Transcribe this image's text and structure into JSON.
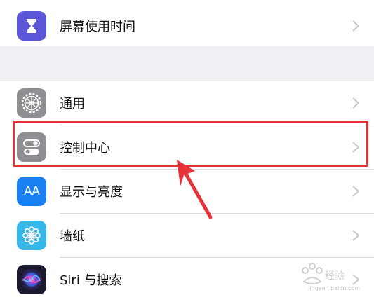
{
  "rows": [
    {
      "label": "屏幕使用时间",
      "icon": "hourglass-icon",
      "color": "#5b55d8"
    },
    {
      "label": "通用",
      "icon": "gear-icon",
      "color": "#8e8e93"
    },
    {
      "label": "控制中心",
      "icon": "toggle-switches-icon",
      "color": "#8e8e93"
    },
    {
      "label": "显示与亮度",
      "icon": "text-size-icon",
      "color": "#1a7ff0",
      "icon_text": "AA"
    },
    {
      "label": "墙纸",
      "icon": "flower-icon",
      "color": "#37b6e8"
    },
    {
      "label": "Siri 与搜索",
      "icon": "siri-icon",
      "color": "#1b1b2e"
    }
  ],
  "annotation": {
    "highlight_color": "#e8323a",
    "highlighted_row": "控制中心"
  },
  "watermark": {
    "text": "Baidu经验",
    "url": "jingyan.baidu.com"
  }
}
